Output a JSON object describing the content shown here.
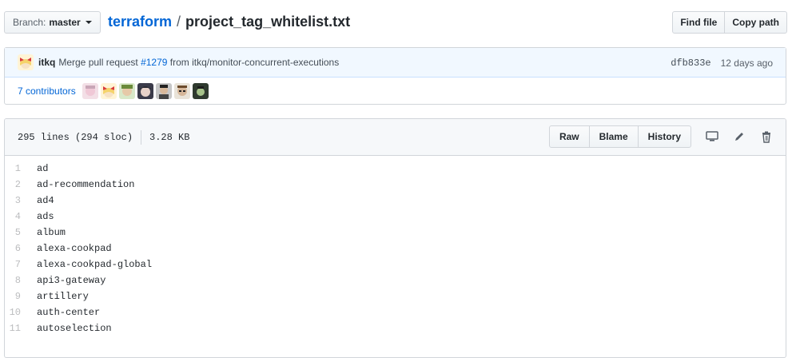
{
  "branch": {
    "prefix": "Branch:",
    "name": "master"
  },
  "breadcrumb": {
    "repo": "terraform",
    "separator": "/",
    "file": "project_tag_whitelist.txt"
  },
  "header_buttons": {
    "find_file": "Find file",
    "copy_path": "Copy path"
  },
  "commit": {
    "author": "itkq",
    "message_prefix": "Merge pull request",
    "pr": "#1279",
    "message_suffix": "from itkq/monitor-concurrent-executions",
    "sha": "dfb833e",
    "time": "12 days ago"
  },
  "contributors": {
    "label": "7 contributors",
    "count": 7
  },
  "file": {
    "lines_info": "295 lines (294 sloc)",
    "size": "3.28 KB",
    "buttons": {
      "raw": "Raw",
      "blame": "Blame",
      "history": "History"
    }
  },
  "code_lines": [
    {
      "n": "1",
      "t": "ad"
    },
    {
      "n": "2",
      "t": "ad-recommendation"
    },
    {
      "n": "3",
      "t": "ad4"
    },
    {
      "n": "4",
      "t": "ads"
    },
    {
      "n": "5",
      "t": "album"
    },
    {
      "n": "6",
      "t": "alexa-cookpad"
    },
    {
      "n": "7",
      "t": "alexa-cookpad-global"
    },
    {
      "n": "8",
      "t": "api3-gateway"
    },
    {
      "n": "9",
      "t": "artillery"
    },
    {
      "n": "10",
      "t": "auth-center"
    },
    {
      "n": "11",
      "t": "autoselection"
    }
  ],
  "colors": {
    "link": "#0366d6",
    "commit_bg": "#f1f8ff"
  },
  "icons": [
    "desktop-icon",
    "pencil-icon",
    "trash-icon"
  ]
}
